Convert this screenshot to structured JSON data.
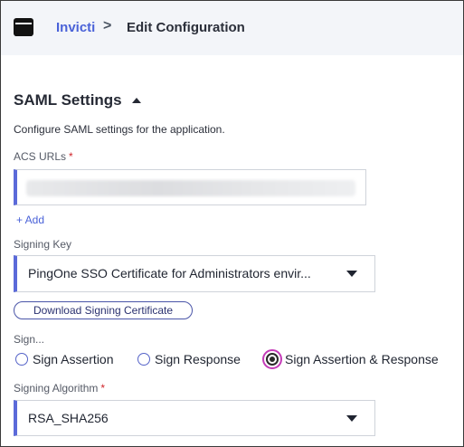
{
  "breadcrumb": {
    "app_link": "Invicti",
    "separator": ">",
    "current": "Edit Configuration"
  },
  "icons": {
    "app": "app-window-icon",
    "section_toggle": "caret-up-icon",
    "dropdown": "caret-down-icon"
  },
  "section": {
    "title": "SAML Settings",
    "description": "Configure SAML settings for the application."
  },
  "acs": {
    "label": "ACS URLs",
    "required_mark": "*",
    "add_label": "+ Add"
  },
  "signing_key": {
    "label": "Signing Key",
    "selected": "PingOne SSO Certificate for Administrators envir..."
  },
  "download_button": "Download Signing Certificate",
  "sign": {
    "label": "Sign...",
    "options": [
      "Sign Assertion",
      "Sign Response",
      "Sign Assertion & Response"
    ],
    "selected_index": 2
  },
  "signing_algorithm": {
    "label": "Signing Algorithm",
    "required_mark": "*",
    "selected": "RSA_SHA256"
  },
  "colors": {
    "accent": "#4a62d8",
    "field_bar": "#5b6ad9",
    "required": "#d0262b",
    "focus_ring": "#c43bb8",
    "topbar_bg": "#f3f5f9"
  }
}
